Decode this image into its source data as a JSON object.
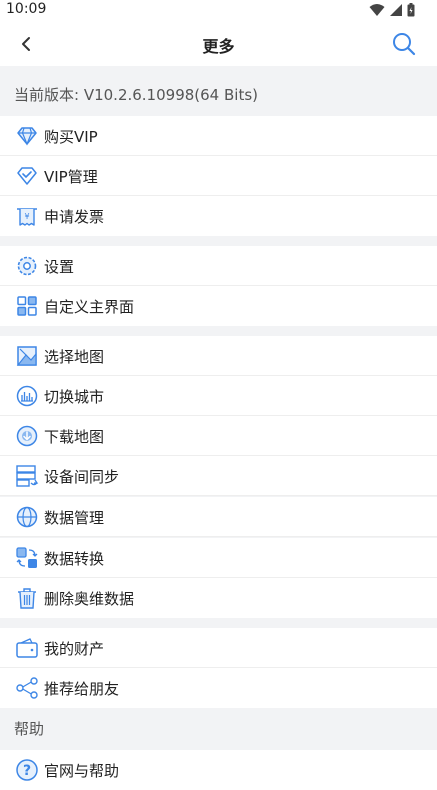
{
  "status_bar": {
    "time": "10:09"
  },
  "nav": {
    "title": "更多"
  },
  "version_text": "当前版本: V10.2.6.10998(64 Bits)",
  "groups": {
    "vip": [
      "购买VIP",
      "VIP管理",
      "申请发票"
    ],
    "settings": [
      "设置",
      "自定义主界面"
    ],
    "map": [
      "选择地图",
      "切换城市",
      "下载地图",
      "设备间同步",
      "数据管理",
      "数据转换",
      "删除奥维数据"
    ],
    "assets": [
      "我的财产",
      "推荐给朋友"
    ]
  },
  "help": {
    "header": "帮助",
    "items": [
      "官网与帮助"
    ]
  },
  "colors": {
    "accent": "#3d86e6",
    "icon_light": "#8ab8f0",
    "background": "#f2f3f5"
  }
}
